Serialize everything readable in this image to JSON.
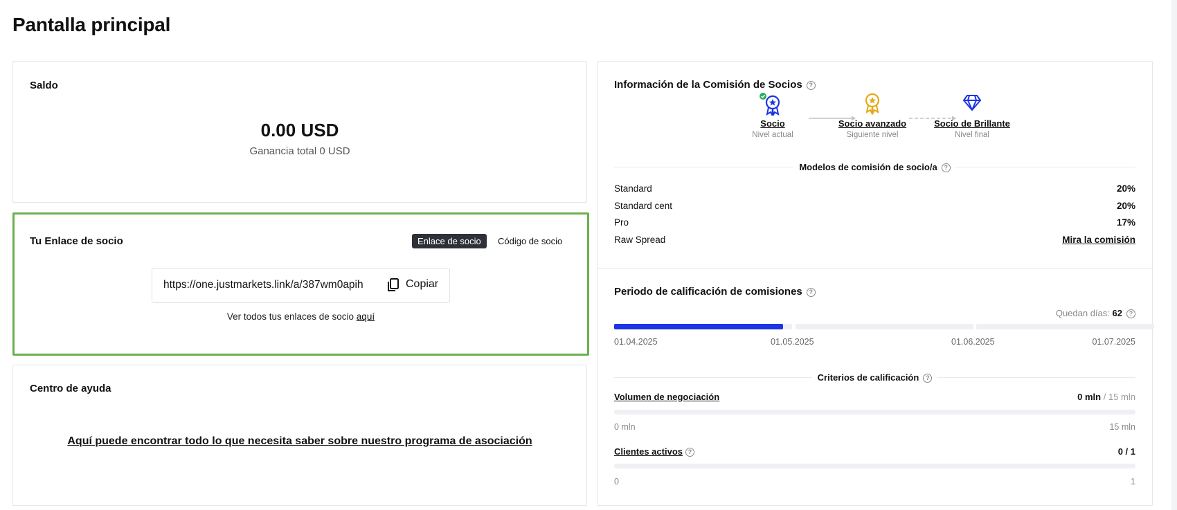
{
  "page": {
    "title": "Pantalla principal"
  },
  "balance": {
    "title": "Saldo",
    "amount": "0.00 USD",
    "total_earnings": "Ganancia total 0 USD"
  },
  "partner_link": {
    "title": "Tu Enlace de socio",
    "tabs": [
      {
        "label": "Enlace de socio",
        "active": true
      },
      {
        "label": "Código de socio",
        "active": false
      }
    ],
    "url": "https://one.justmarkets.link/a/387wm0apih",
    "copy_label": "Copiar",
    "note_text": "Ver todos tus enlaces de socio",
    "note_link": "aquí"
  },
  "help_center": {
    "title": "Centro de ayuda",
    "link": "Aquí puede encontrar todo lo que necesita saber sobre nuestro programa de asociación"
  },
  "commission_info": {
    "title": "Información de la Comisión de Socios",
    "levels": [
      {
        "name": "Socio",
        "status": "Nivel actual",
        "icon": "medal-blue-icon",
        "color": "#1b34e6",
        "current": true
      },
      {
        "name": "Socio avanzado",
        "status": "Siguiente nivel",
        "icon": "medal-gold-icon",
        "color": "#e6a817"
      },
      {
        "name": "Socio de Brillante",
        "status": "Nivel final",
        "icon": "diamond-icon",
        "color": "#1b34e6"
      }
    ],
    "models_title": "Modelos de comisión de socio/a",
    "models": [
      {
        "label": "Standard",
        "value": "20%"
      },
      {
        "label": "Standard cent",
        "value": "20%"
      },
      {
        "label": "Pro",
        "value": "17%"
      },
      {
        "label": "Raw Spread",
        "value": "Mira la comisión",
        "link": true
      }
    ]
  },
  "qualification": {
    "title": "Periodo de calificación de comisiones",
    "days_left_label": "Quedan días:",
    "days_left_value": "62",
    "period_progress": 0.95,
    "dates": [
      "01.04.2025",
      "01.05.2025",
      "01.06.2025",
      "01.07.2025"
    ],
    "criteria_title": "Criterios de calificación",
    "criteria": [
      {
        "label": "Volumen de negociación",
        "current": "0 mln",
        "target": "/ 15 mln",
        "min": "0 mln",
        "max": "15 mln",
        "progress": 0
      },
      {
        "label": "Clientes activos",
        "current": "0 / 1",
        "target": "",
        "min": "0",
        "max": "1",
        "progress": 0
      }
    ]
  },
  "colors": {
    "accent": "#1b34e6",
    "highlight_border": "#6ab04c",
    "success": "#27ae60",
    "gold": "#e6a817"
  }
}
